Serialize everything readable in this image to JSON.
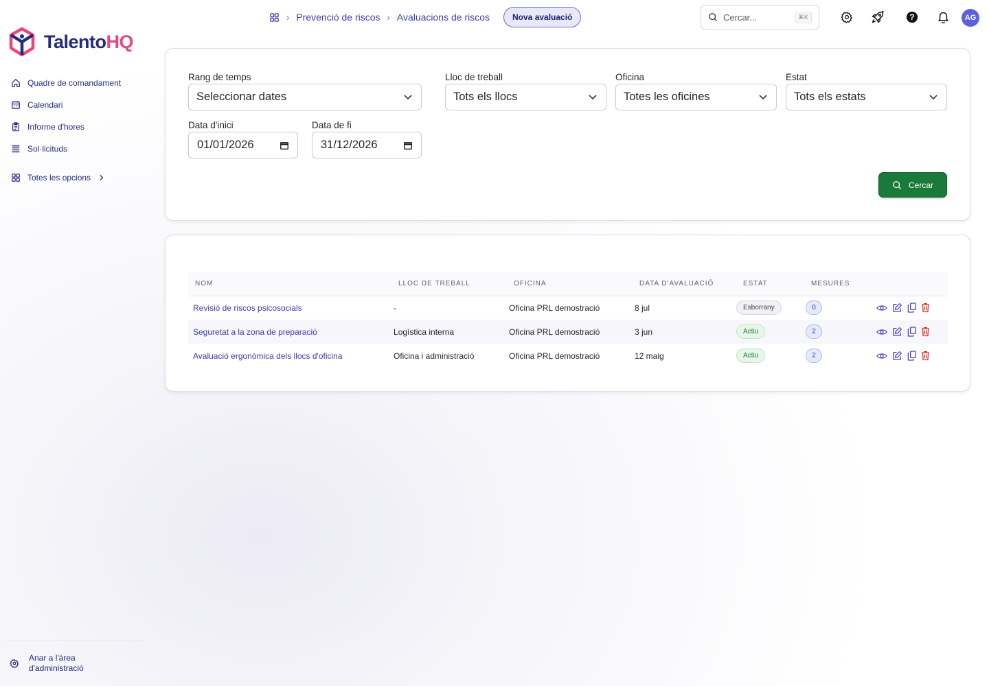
{
  "brand": {
    "part1": "Talento",
    "part2": "HQ"
  },
  "sidebar": {
    "items": [
      {
        "label": "Quadre de comandament",
        "icon": "home-icon"
      },
      {
        "label": "Calendari",
        "icon": "calendar-icon"
      },
      {
        "label": "Informe d'hores",
        "icon": "clipboard-icon"
      },
      {
        "label": "Sol·licituds",
        "icon": "list-icon"
      }
    ],
    "all_options": "Totes les opcions",
    "admin_line1": "Anar a l'àrea",
    "admin_line2": "d'administració"
  },
  "header": {
    "breadcrumb": [
      "Prevenció de riscos",
      "Avaluacions de riscos"
    ],
    "new_button": "Nova avaluació",
    "search_placeholder": "Cercar...",
    "search_shortcut": "⌘K",
    "avatar_initials": "AG"
  },
  "filters": {
    "time_range": {
      "label": "Rang de temps",
      "value": "Seleccionar dates"
    },
    "workplace": {
      "label": "Lloc de treball",
      "value": "Tots els llocs"
    },
    "office": {
      "label": "Oficina",
      "value": "Totes les oficines"
    },
    "status": {
      "label": "Estat",
      "value": "Tots els estats"
    },
    "start_date": {
      "label": "Data d'inici",
      "value": "01/01/2026"
    },
    "end_date": {
      "label": "Data de fi",
      "value": "31/12/2026"
    },
    "search_button": "Cercar"
  },
  "table": {
    "columns": [
      "Nom",
      "Lloc de treball",
      "Oficina",
      "Data d'avaluació",
      "Estat",
      "Mesures"
    ],
    "rows": [
      {
        "name": "Revisió de riscos psicosocials",
        "workplace": "-",
        "office": "Oficina PRL demostració",
        "date": "8 jul",
        "status": "Esborrany",
        "status_type": "draft",
        "measures": "0"
      },
      {
        "name": "Seguretat a la zona de preparació",
        "workplace": "Logística interna",
        "office": "Oficina PRL demostració",
        "date": "3 jun",
        "status": "Actiu",
        "status_type": "active",
        "measures": "2"
      },
      {
        "name": "Avaluació ergonòmica dels llocs d'oficina",
        "workplace": "Oficina i administració",
        "office": "Oficina PRL demostració",
        "date": "12 maig",
        "status": "Actiu",
        "status_type": "active",
        "measures": "2"
      }
    ]
  },
  "colors": {
    "brand_navy": "#252a7d",
    "brand_pink": "#e8487b",
    "primary_green": "#1a7a3a",
    "link": "#3e3aa6",
    "danger": "#d93025"
  }
}
